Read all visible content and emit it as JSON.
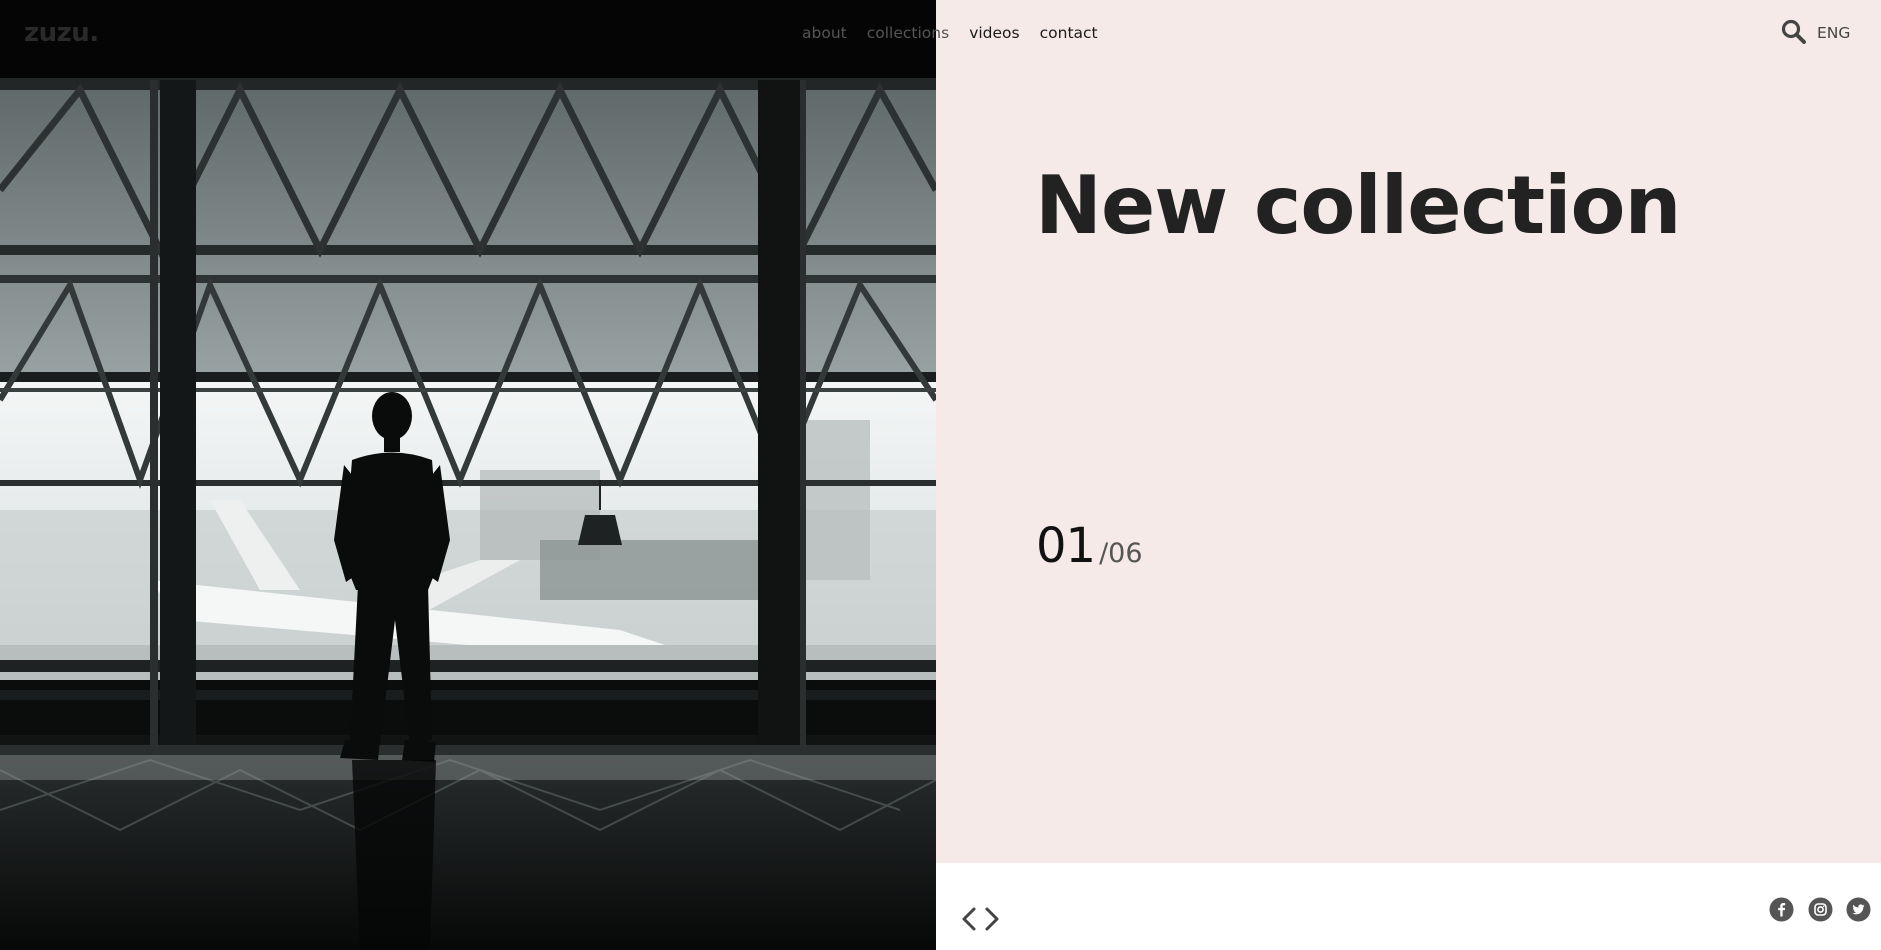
{
  "brand": {
    "logo_text": "zuzu."
  },
  "nav": {
    "items": [
      {
        "label": "about"
      },
      {
        "label": "collections"
      },
      {
        "label": "videos"
      },
      {
        "label": "contact"
      }
    ]
  },
  "header": {
    "search_icon": "search-icon",
    "language": "ENG"
  },
  "hero": {
    "title": "New collection",
    "slide_current": "01",
    "slide_total": "/06",
    "photo": "silhouette-man-airport-window"
  },
  "footer": {
    "prev_icon": "chevron-left-icon",
    "next_icon": "chevron-right-icon",
    "social": [
      {
        "icon": "facebook-icon"
      },
      {
        "icon": "instagram-icon"
      },
      {
        "icon": "twitter-icon"
      }
    ]
  },
  "colors": {
    "panel_pink": "#f6eae8",
    "text_dark": "#222222",
    "icon_gray": "#555555",
    "photo_dark": "#0b0c0c"
  }
}
